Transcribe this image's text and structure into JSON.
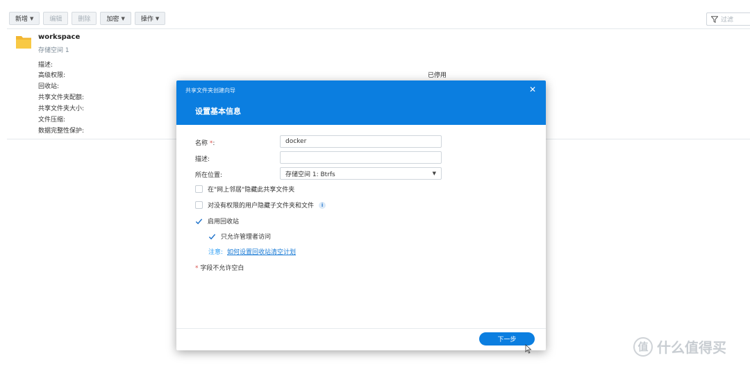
{
  "toolbar": {
    "create": "新增",
    "edit": "编辑",
    "delete": "删除",
    "encrypt": "加密",
    "action": "操作",
    "filter_placeholder": "过滤"
  },
  "share": {
    "name": "workspace",
    "volume": "存储空间 1",
    "properties": [
      {
        "label": "描述:"
      },
      {
        "label": "高级权限:",
        "value": "已停用"
      },
      {
        "label": "回收站:"
      },
      {
        "label": "共享文件夹配额:"
      },
      {
        "label": "共享文件夹大小:"
      },
      {
        "label": "文件压缩:"
      },
      {
        "label": "数据完整性保护:"
      }
    ]
  },
  "dialog": {
    "wizard_title": "共享文件夹创建向导",
    "step_title": "设置基本信息",
    "close_icon": "close-icon",
    "name_label": "名称",
    "name_required_mark": "*",
    "name_label_suffix": ":",
    "name_value": "docker",
    "desc_label": "描述:",
    "desc_value": "",
    "location_label": "所在位置:",
    "location_value": "存储空间 1:  Btrfs",
    "options": {
      "hide_network": {
        "label": "在\"网上邻居\"隐藏此共享文件夹",
        "checked": false
      },
      "hide_no_permission": {
        "label": "对没有权限的用户隐藏子文件夹和文件",
        "checked": false
      },
      "enable_recycle": {
        "label": "启用回收站",
        "checked": true
      },
      "admin_only": {
        "label": "只允许管理者访问",
        "checked": true
      }
    },
    "note_label": "注意:",
    "note_link": "如何设置回收站清空计划",
    "required_note_mark": "*",
    "required_note": "字段不允许空白",
    "next_button": "下一步"
  },
  "watermark": {
    "badge": "值",
    "text": "什么值得买"
  },
  "colors": {
    "accent": "#0b7ee0",
    "link": "#1a7bd6",
    "required": "#d9534f"
  }
}
